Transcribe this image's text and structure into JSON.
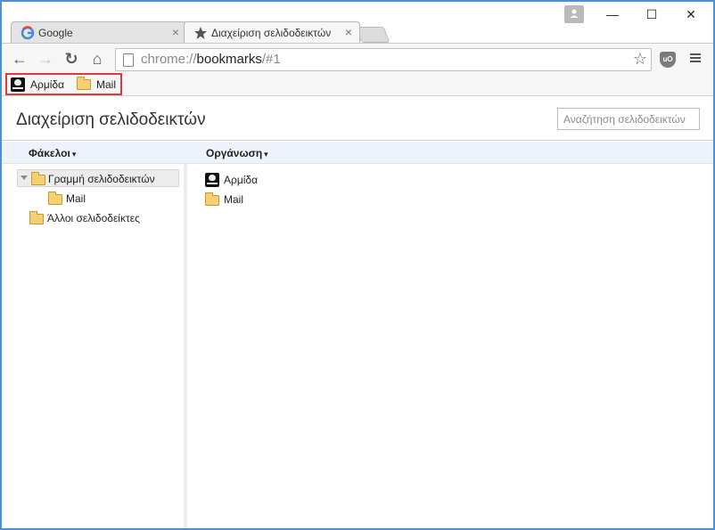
{
  "tabs": [
    {
      "title": "Google",
      "icon": "google-g-icon",
      "close": "×"
    },
    {
      "title": "Διαχείριση σελιδοδεικτών",
      "icon": "star-icon",
      "close": "×"
    }
  ],
  "window_controls": {
    "minimize": "—",
    "maximize": "☐",
    "close": "✕"
  },
  "toolbar": {
    "back": "←",
    "forward": "→",
    "reload": "↻",
    "home": "⌂",
    "url_scheme": "chrome://",
    "url_host": "bookmarks",
    "url_path": "/#1",
    "star": "☆",
    "ublock_label": "uO"
  },
  "bookmarks_bar": {
    "items": [
      {
        "label": "Αρμίδα",
        "icon": "pirate-flag-icon"
      },
      {
        "label": "Mail",
        "icon": "folder-icon"
      }
    ]
  },
  "page": {
    "title": "Διαχείριση σελιδοδεικτών",
    "search_placeholder": "Αναζήτηση σελιδοδεικτών"
  },
  "columns": {
    "folders_menu": "Φάκελοι",
    "organize_menu": "Οργάνωση",
    "caret": "▾"
  },
  "tree": [
    {
      "label": "Γραμμή σελιδοδεικτών",
      "expanded": true,
      "selected": true
    },
    {
      "label": "Mail"
    },
    {
      "label": "Άλλοι σελιδοδείκτες"
    }
  ],
  "list": [
    {
      "label": "Αρμίδα",
      "icon": "pirate-flag-icon"
    },
    {
      "label": "Mail",
      "icon": "folder-icon"
    }
  ],
  "colors": {
    "window_border": "#4a90d9",
    "highlight_box": "#e03a3a",
    "column_header_bg": "#edf2fb",
    "folder_fill": "#f4cf73"
  }
}
